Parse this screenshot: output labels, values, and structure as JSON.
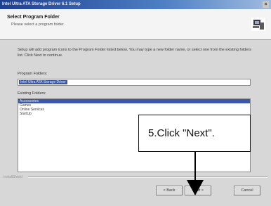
{
  "window": {
    "title": "Intel Ultra ATA Storage Driver 6.1 Setup",
    "close_glyph": "×"
  },
  "header": {
    "title": "Select Program Folder",
    "subtitle": "Please select a program folder."
  },
  "body": {
    "instructions": "Setup will add program icons to the Program Folder listed below. You may type a new folder name, or select one from the existing folders list. Click Next to continue.",
    "program_folders_label": "Program Folders:",
    "program_folder_value": "Intel Ultra ATA Storage Driver",
    "existing_folders_label": "Existing Folders:",
    "existing_folders": [
      "Accessories",
      "Games",
      "Online Services",
      "StartUp"
    ],
    "selected_index": 0
  },
  "footer": {
    "brand": "InstallShield",
    "back_label": "< Back",
    "next_label": "Next >",
    "cancel_label": "Cancel"
  },
  "annotation": {
    "text": "5.Click \"Next\"."
  }
}
